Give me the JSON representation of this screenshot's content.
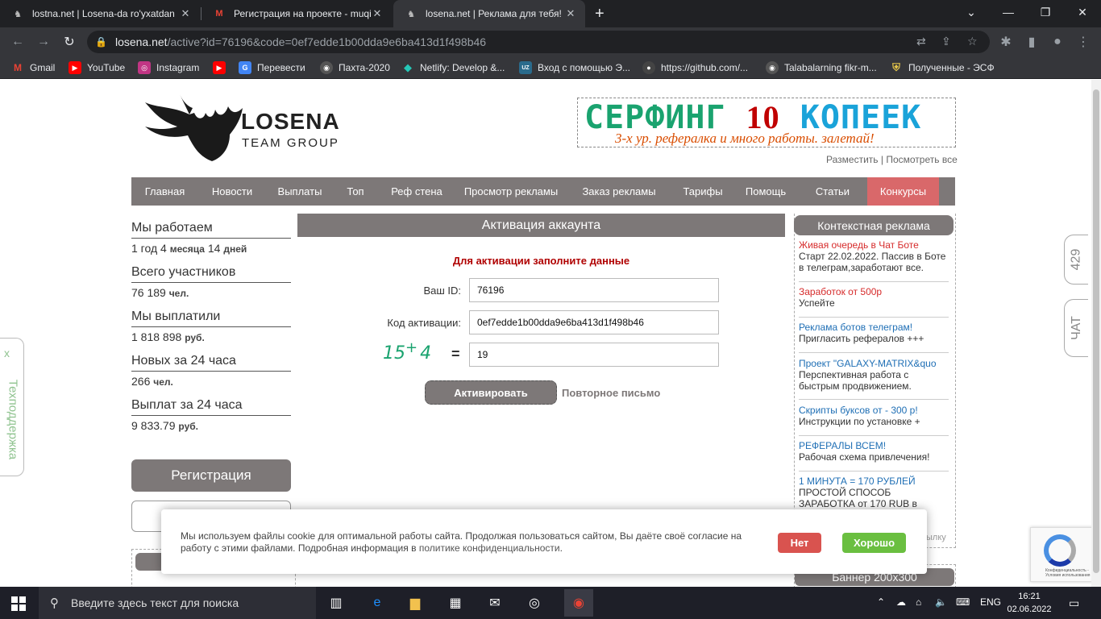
{
  "browser": {
    "tabs": [
      {
        "title": "lostna.net | Losena-da ro'yxatdan",
        "active": false
      },
      {
        "title": "Регистрация на проекте - muqi",
        "active": false
      },
      {
        "title": "losena.net | Реклама для тебя!",
        "active": true
      }
    ],
    "url_host": "losena.net",
    "url_path": "/active?id=76196&code=0ef7edde1b00dda9e6ba413d1f498b46",
    "bookmarks": [
      {
        "label": "Gmail",
        "icon": "gmail-icon"
      },
      {
        "label": "YouTube",
        "icon": "youtube-icon"
      },
      {
        "label": "Instagram",
        "icon": "instagram-icon"
      },
      {
        "label": "",
        "icon": "youtube-icon"
      },
      {
        "label": "Перевести",
        "icon": "translate-icon"
      },
      {
        "label": "Пахта-2020",
        "icon": "globe-icon"
      },
      {
        "label": "Netlify: Develop &...",
        "icon": "netlify-icon"
      },
      {
        "label": "Вход с помощью Э...",
        "icon": "uzex-icon"
      },
      {
        "label": "https://github.com/...",
        "icon": "github-icon"
      },
      {
        "label": "Talabalarning fikr-m...",
        "icon": "globe-icon"
      },
      {
        "label": "Полученные - ЭСФ",
        "icon": "shield-icon"
      }
    ]
  },
  "site": {
    "logo_line1": "LOSENA",
    "logo_line2": "TEAM GROUP",
    "banner": {
      "word1": "СЕРФИНГ",
      "word2": "10",
      "word3": "КОПЕЕК",
      "sub": "3-х ур. рефералка и много работы. залетай!"
    },
    "banner_link_place": "Разместить",
    "banner_link_sep": "|",
    "banner_link_all": "Посмотреть все",
    "nav": [
      "Главная",
      "Новости",
      "Выплаты",
      "Топ",
      "Реф стена",
      "Просмотр рекламы",
      "Заказ рекламы",
      "Тарифы",
      "Помощь",
      "Статьи",
      "Конкурсы"
    ],
    "stats": [
      {
        "label": "Мы работаем",
        "value": "1 год 4",
        "unit": "",
        "extra": [
          [
            "месяца",
            "14"
          ],
          [
            "дней",
            ""
          ]
        ]
      },
      {
        "label": "Всего участников",
        "value": "76 189",
        "unit": "чел."
      },
      {
        "label": "Мы выплатили",
        "value": "1 818 898",
        "unit": "руб."
      },
      {
        "label": "Новых за 24 часа",
        "value": "266",
        "unit": "чел."
      },
      {
        "label": "Выплат за 24 часа",
        "value": "9 833.79",
        "unit": "руб."
      }
    ],
    "register_button": "Регистрация",
    "form": {
      "title": "Активация аккаунта",
      "note": "Для активации заполните данные",
      "id_label": "Ваш ID:",
      "id_value": "76196",
      "code_label": "Код активации:",
      "code_value": "0ef7edde1b00dda9e6ba413d1f498b46",
      "captcha_a": "15",
      "captcha_op": "+",
      "captcha_b": "4",
      "captcha_eq": "=",
      "answer_value": "19",
      "activate_button": "Активировать",
      "resend_link": "Повторное письмо"
    },
    "context_ads_title": "Контекстная реклама",
    "ads": [
      {
        "title": "Живая очередь в Чат Боте",
        "desc": "Старт 22.02.2022. Пассив в Боте в телеграм,заработают все.",
        "color": "#d62b2b"
      },
      {
        "title": "Заработок от 500р",
        "desc": "Успейте",
        "color": "#d62b2b"
      },
      {
        "title": "Реклама ботов телеграм!",
        "desc": "Пригласить рефералов +++",
        "color": "#1f6fb5"
      },
      {
        "title": "Проект \"GALAXY-MATRIX&quo",
        "desc": "Перспективная работа с быстрым продвижением.",
        "color": "#1f6fb5"
      },
      {
        "title": "Скрипты буксов от - 300 р!",
        "desc": "Инструкции по установке +",
        "color": "#1f6fb5"
      },
      {
        "title": "РЕФЕРАЛЫ ВСЕМ!",
        "desc": "Рабочая схема привлечения!",
        "color": "#1f6fb5"
      },
      {
        "title": "1 МИНУТА = 170 РУБЛЕЙ",
        "desc": "ПРОСТОЙ СПОСОБ ЗАРАБОТКА от 170 RUB в",
        "color": "#1f6fb5"
      }
    ],
    "ads_more": "ылку",
    "banner2_title": "Баннер 200x300",
    "side_tab_count": "429",
    "side_tab_chat": "ЧАТ",
    "support_label": "Техподдержка",
    "support_close": "x"
  },
  "cookie": {
    "text": "Мы используем файлы cookie для оптимальной работы сайта. Продолжая пользоваться сайтом, Вы даёте своё согласие на работу с этими файлами. Подробная информация в",
    "link": "политике конфиденциальности",
    "end": ".",
    "no_button": "Нет",
    "ok_button": "Хорошо"
  },
  "recaptcha_text": "Конфиденциальность - Условия использования",
  "taskbar": {
    "search_placeholder": "Введите здесь текст для поиска",
    "lang": "ENG",
    "time": "16:21",
    "date": "02.06.2022"
  },
  "colors": {
    "nav_bg": "#7d7878",
    "nav_highlight": "#d9686a",
    "note_red": "#b00000",
    "captcha_green": "#1aa36f",
    "cookie_no": "#d9534f",
    "cookie_ok": "#6abf40"
  }
}
